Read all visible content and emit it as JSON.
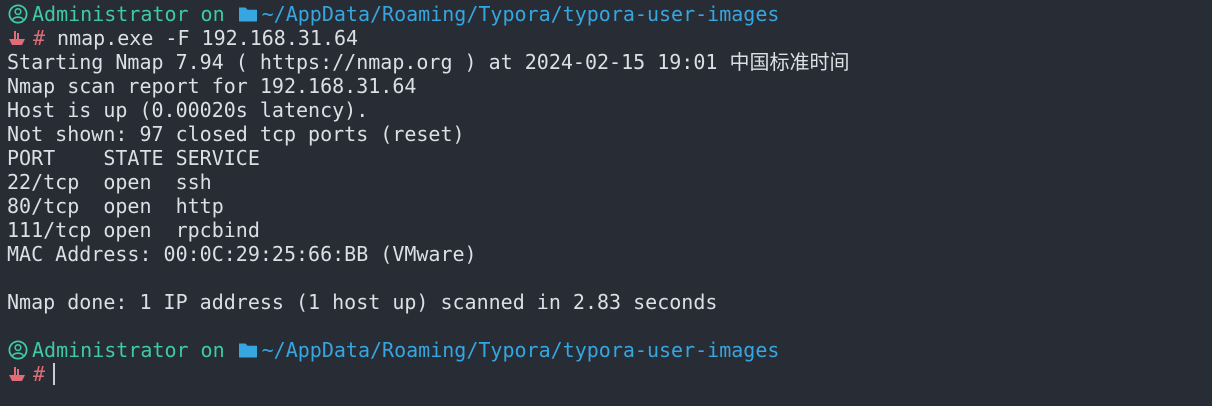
{
  "prompt": {
    "user": "Administrator",
    "connector": "on",
    "path": "~/AppData/Roaming/Typora/typora-user-images",
    "symbol": "#"
  },
  "command": "nmap.exe -F 192.168.31.64",
  "output": [
    "Starting Nmap 7.94 ( https://nmap.org ) at 2024-02-15 19:01 中国标准时间",
    "Nmap scan report for 192.168.31.64",
    "Host is up (0.00020s latency).",
    "Not shown: 97 closed tcp ports (reset)",
    "PORT    STATE SERVICE",
    "22/tcp  open  ssh",
    "80/tcp  open  http",
    "111/tcp open  rpcbind",
    "MAC Address: 00:0C:29:25:66:BB (VMware)",
    "",
    "Nmap done: 1 IP address (1 host up) scanned in 2.83 seconds"
  ],
  "colors": {
    "background": "#282c34",
    "text": "#dcdfe4",
    "user": "#3ec9a7",
    "path": "#35a6e0",
    "prompt_symbol": "#e06c75"
  },
  "icons": {
    "user": "user-circle-icon",
    "folder": "folder-icon",
    "prompt": "ship-icon"
  }
}
